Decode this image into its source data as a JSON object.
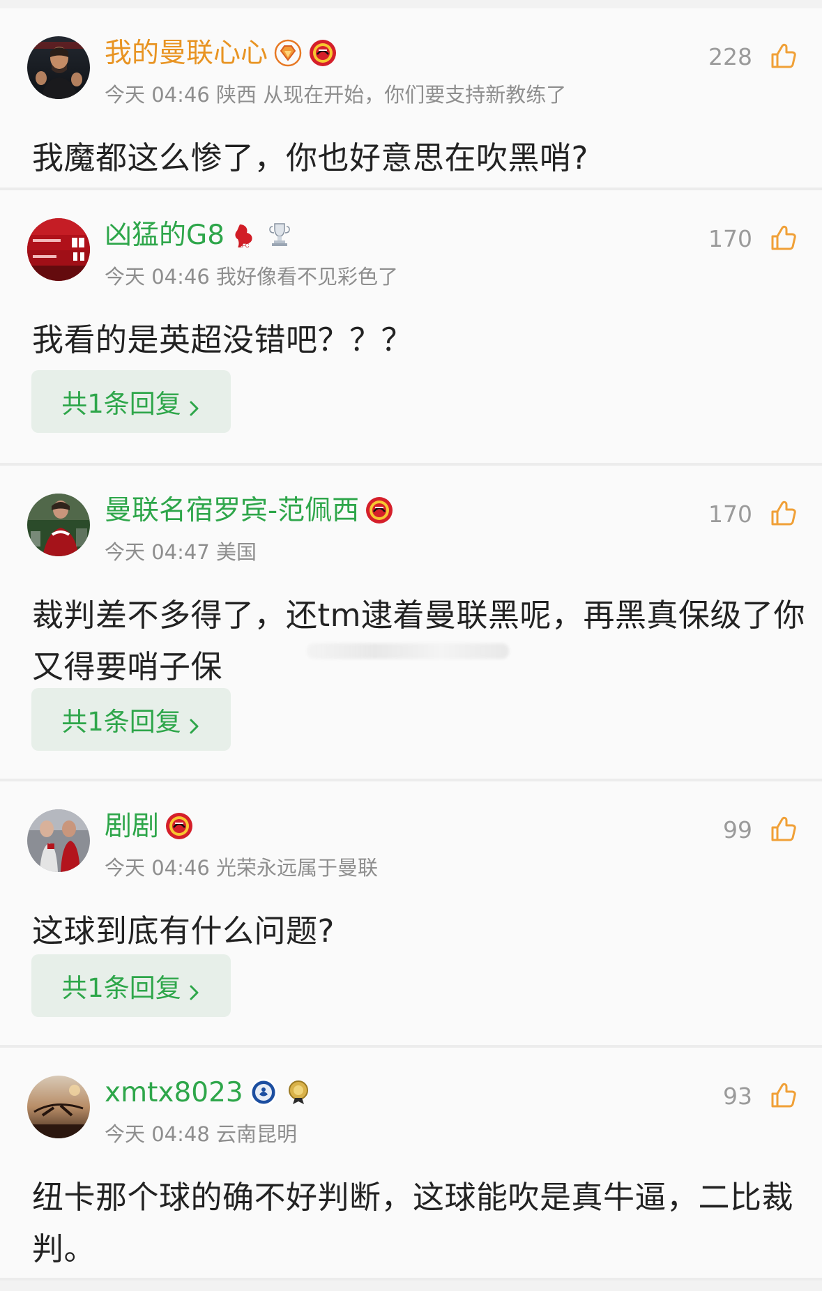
{
  "comments": [
    {
      "id": 1,
      "username": "我的曼联心心",
      "username_color": "#e89423",
      "meta": "今天 04:46 陕西 从现在开始，你们要支持新教练了",
      "likes": "228",
      "text": "我魔都这么惨了，你也好意思在吹黑哨?",
      "badges": [
        "diamond-badge-icon",
        "man-utd-badge-icon"
      ],
      "avatar_icon": "manager-photo-avatar"
    },
    {
      "id": 2,
      "username": "凶猛的G8",
      "username_color": "#2ea64a",
      "meta": "今天 04:46 我好像看不见彩色了",
      "likes": "170",
      "text": "我看的是英超没错吧？？？",
      "reply_label": "共1条回复",
      "badges": [
        "liverpool-badge-icon",
        "premier-league-trophy-icon"
      ],
      "avatar_icon": "scoreboard-avatar"
    },
    {
      "id": 3,
      "username": "曼联名宿罗宾-范佩西",
      "username_color": "#2ea64a",
      "meta": "今天 04:47 美国",
      "likes": "170",
      "text": "裁判差不多得了，还tm逮着曼联黑呢，再黑真保级了你又得要哨子保",
      "reply_label": "共1条回复",
      "badges": [
        "man-utd-badge-icon"
      ],
      "avatar_icon": "player-photo-avatar"
    },
    {
      "id": 4,
      "username": "剧剧",
      "username_color": "#2ea64a",
      "meta": "今天 04:46 光荣永远属于曼联",
      "likes": "99",
      "text": "这球到底有什么问题?",
      "reply_label": "共1条回复",
      "badges": [
        "man-utd-badge-icon"
      ],
      "avatar_icon": "players-photo-avatar"
    },
    {
      "id": 5,
      "username": "xmtx8023",
      "username_color": "#2ea64a",
      "meta": "今天 04:48 云南昆明",
      "likes": "93",
      "text": "纽卡那个球的确不好判断，这球能吹是真牛逼，二比裁判。",
      "badges": [
        "chelsea-badge-icon",
        "gold-medal-badge-icon"
      ],
      "avatar_icon": "sunset-photo-avatar"
    }
  ],
  "colors": {
    "background": "#f2f2f2",
    "card": "#fafafa",
    "divider": "#ececec",
    "accent_green": "#2ea64a",
    "accent_orange": "#e89423",
    "like_orange": "#f0a037",
    "reply_bg": "#e7efe9",
    "meta_gray": "#8e8e8e",
    "text_dark": "#222222"
  }
}
